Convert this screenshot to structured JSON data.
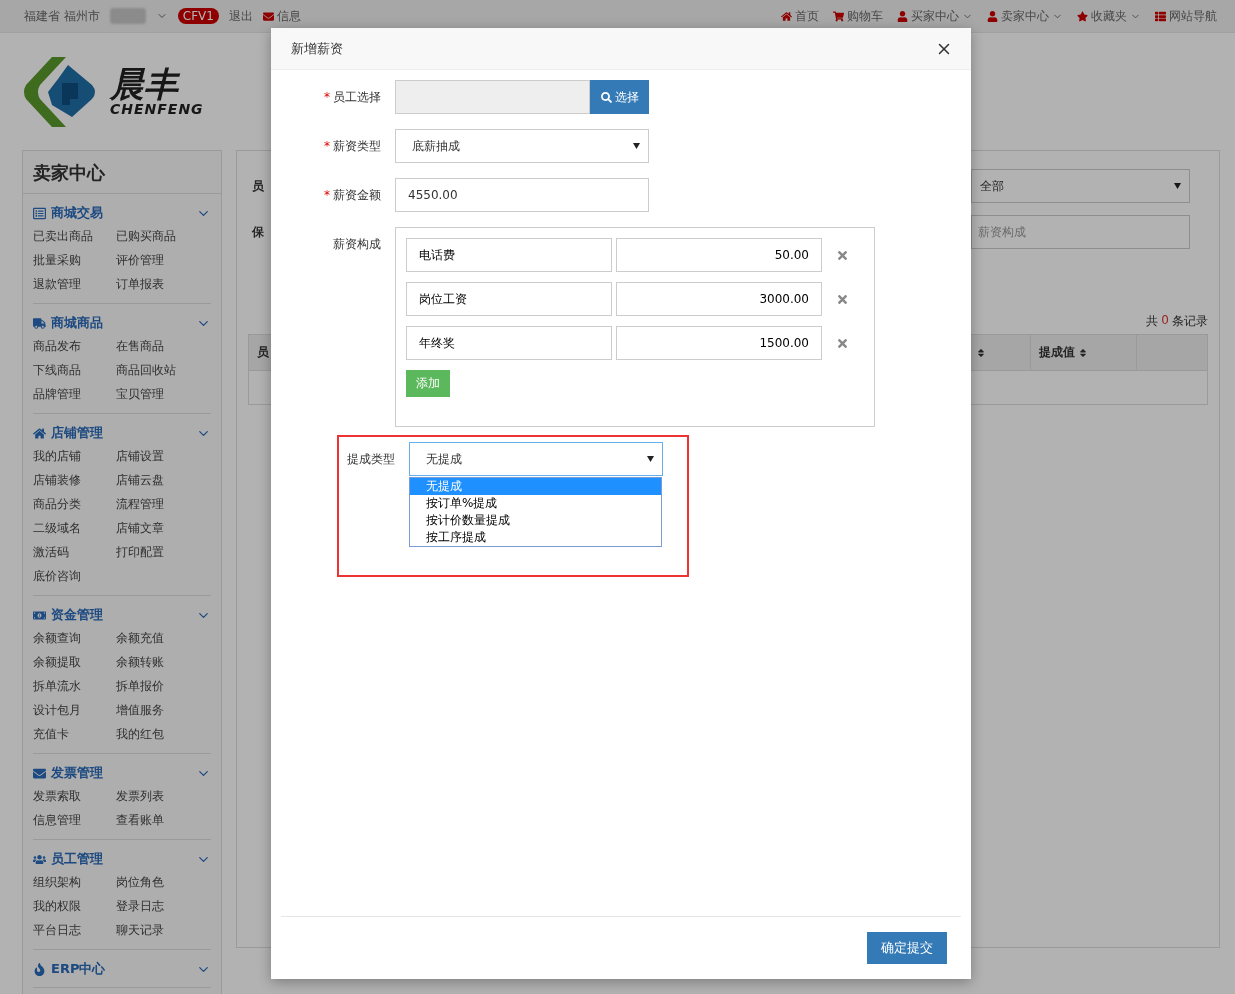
{
  "top_bar": {
    "location": "福建省 福州市",
    "badge": "CFV1",
    "left_links": [
      {
        "label": "退出",
        "kind": "plain"
      },
      {
        "label": "信息",
        "kind": "mail"
      }
    ],
    "right_links": [
      {
        "label": "首页",
        "kind": "home",
        "dropdown": false
      },
      {
        "label": "购物车",
        "kind": "cart",
        "dropdown": false
      },
      {
        "label": "买家中心",
        "kind": "user",
        "dropdown": true
      },
      {
        "label": "卖家中心",
        "kind": "user",
        "dropdown": true
      },
      {
        "label": "收藏夹",
        "kind": "star",
        "dropdown": true
      },
      {
        "label": "网站导航",
        "kind": "list",
        "dropdown": false
      }
    ]
  },
  "logo": {
    "name": "晨丰",
    "latin": "CHENFENG"
  },
  "sidebar": {
    "title": "卖家中心",
    "sections": [
      {
        "title": "商城交易",
        "kind": "list",
        "items": [
          "已卖出商品",
          "已购买商品",
          "批量采购",
          "评价管理",
          "退款管理",
          "订单报表"
        ]
      },
      {
        "title": "商城商品",
        "kind": "truck",
        "items": [
          "商品发布",
          "在售商品",
          "下线商品",
          "商品回收站",
          "品牌管理",
          "宝贝管理"
        ]
      },
      {
        "title": "店铺管理",
        "kind": "home",
        "items": [
          "我的店铺",
          "店铺设置",
          "店铺装修",
          "店铺云盘",
          "商品分类",
          "流程管理",
          "二级域名",
          "店铺文章",
          "激活码",
          "打印配置",
          "底价咨询"
        ]
      },
      {
        "title": "资金管理",
        "kind": "money",
        "items": [
          "余额查询",
          "余额充值",
          "余额提取",
          "余额转账",
          "拆单流水",
          "拆单报价",
          "设计包月",
          "增值服务",
          "充值卡",
          "我的红包"
        ]
      },
      {
        "title": "发票管理",
        "kind": "mail",
        "items": [
          "发票索取",
          "发票列表",
          "信息管理",
          "查看账单"
        ]
      },
      {
        "title": "员工管理",
        "kind": "users",
        "items": [
          "组织架构",
          "岗位角色",
          "我的权限",
          "登录日志",
          "平台日志",
          "聊天记录"
        ]
      },
      {
        "title": "ERP中心",
        "kind": "fire"
      }
    ]
  },
  "main": {
    "labels": [
      "员",
      "保"
    ],
    "filter_select": "全部",
    "filter_placeholder": "薪资构成",
    "record_count": {
      "prefix": "共",
      "count": "0",
      "suffix": "条记录"
    },
    "table": {
      "columns": [
        {
          "label": "员",
          "sortable": false
        },
        {
          "sortable": true
        },
        {
          "label": "提成值",
          "sortable": true
        }
      ]
    }
  },
  "modal": {
    "title": "新增薪资",
    "employee": {
      "label": "员工选择",
      "required_mark": "*",
      "button": "选择"
    },
    "salary_type": {
      "label": "薪资类型",
      "required_mark": "*",
      "value": "底薪抽成"
    },
    "amount": {
      "label": "薪资金额",
      "required_mark": "*",
      "value": "4550.00"
    },
    "composition": {
      "label": "薪资构成",
      "add_button": "添加",
      "rows": [
        {
          "name": "电话费",
          "amount": "50.00"
        },
        {
          "name": "岗位工资",
          "amount": "3000.00"
        },
        {
          "name": "年终奖",
          "amount": "1500.00"
        }
      ]
    },
    "commission": {
      "label": "提成类型",
      "value": "无提成",
      "expanded": true,
      "highlighted": true,
      "options": [
        {
          "label": "无提成",
          "selected": true
        },
        {
          "label": "按订单%提成",
          "selected": false
        },
        {
          "label": "按计价数量提成",
          "selected": false
        },
        {
          "label": "按工序提成",
          "selected": false
        }
      ]
    },
    "submit": "确定提交"
  }
}
